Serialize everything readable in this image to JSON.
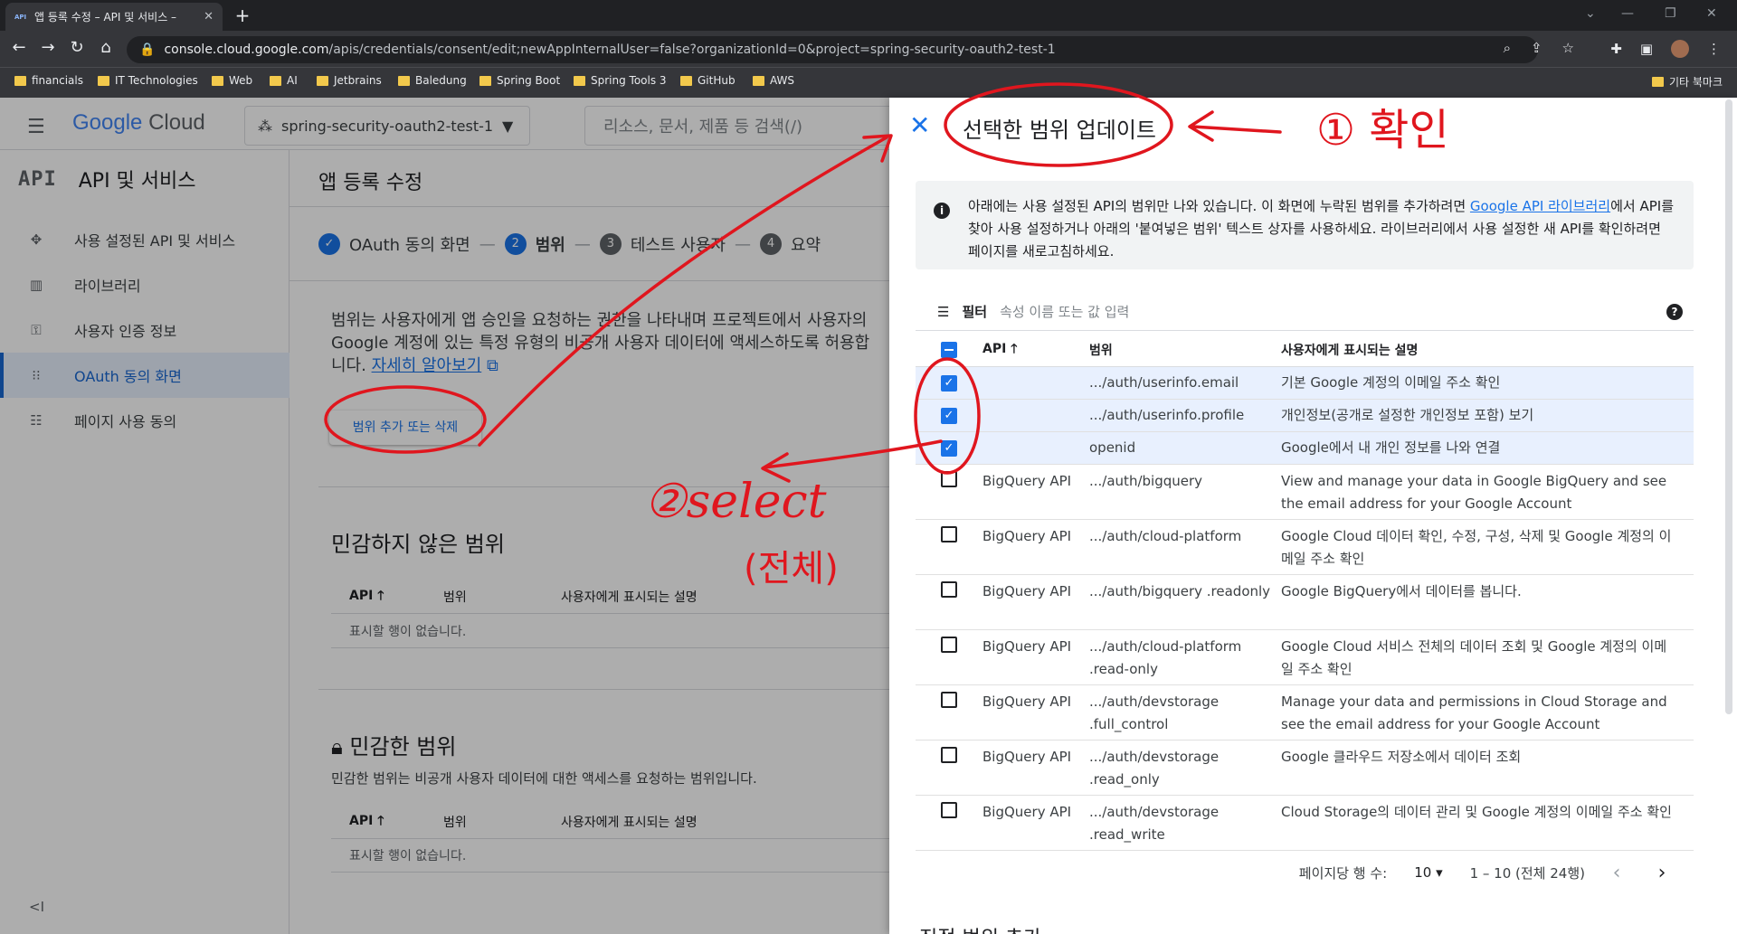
{
  "browser": {
    "tab_title": "앱 등록 수정 – API 및 서비스 –",
    "favicon_text": "API",
    "url_host": "console.cloud.google.com",
    "url_path": "/apis/credentials/consent/edit;newAppInternalUser=false?organizationId=0&project=spring-security-oauth2-test-1",
    "bookmarks": [
      "financials",
      "IT Technologies",
      "Web",
      "AI",
      "Jetbrains",
      "Baledung",
      "Spring Boot",
      "Spring Tools 3",
      "GitHub",
      "AWS"
    ],
    "other_bookmarks": "기타 북마크"
  },
  "header": {
    "logo_google": "Google",
    "logo_cloud": "Cloud",
    "project": "spring-security-oauth2-test-1",
    "search_placeholder": "리소스, 문서, 제품 등 검색(/)"
  },
  "sidebar": {
    "icon_text": "API",
    "title": "API 및 서비스",
    "items": [
      {
        "label": "사용 설정된 API 및 서비스",
        "icon": "diamond-icon"
      },
      {
        "label": "라이브러리",
        "icon": "library-icon"
      },
      {
        "label": "사용자 인증 정보",
        "icon": "key-icon"
      },
      {
        "label": "OAuth 동의 화면",
        "icon": "consent-icon",
        "active": true
      },
      {
        "label": "페이지 사용 동의",
        "icon": "settings-list-icon"
      }
    ],
    "collapse": "<I"
  },
  "main": {
    "page_title": "앱 등록 수정",
    "steps": [
      {
        "num": "✓",
        "label": "OAuth 동의 화면"
      },
      {
        "num": "2",
        "label": "범위"
      },
      {
        "num": "3",
        "label": "테스트 사용자"
      },
      {
        "num": "4",
        "label": "요약"
      }
    ],
    "description": "범위는 사용자에게 앱 승인을 요청하는 권한을 나타내며 프로젝트에서 사용자의 Google 계정에 있는 특정 유형의 비공개 사용자 데이터에 액세스하도록 허용합니다.",
    "learn_more": "자세히 알아보기",
    "add_scope_button": "범위 추가 또는 삭제",
    "non_sensitive_title": "민감하지 않은 범위",
    "sensitive_title": "민감한 범위",
    "sensitive_desc": "민감한 범위는 비공개 사용자 데이터에 대한 액세스를 요청하는 범위입니다.",
    "col_api": "API",
    "col_scope": "범위",
    "col_desc": "사용자에게 표시되는 설명",
    "no_rows": "표시할 행이 없습니다."
  },
  "drawer": {
    "title": "선택한 범위 업데이트",
    "info_text_1": "아래에는 사용 설정된 API의 범위만 나와 있습니다. 이 화면에 누락된 범위를 추가하려면 ",
    "info_link": "Google API 라이브러리",
    "info_text_2": "에서 API를 찾아 사용 설정하거나 아래의 '붙여넣은 범위' 텍스트 상자를 사용하세요. 라이브러리에서 사용 설정한 새 API를 확인하려면 페이지를 새로고침하세요.",
    "filter_label": "필터",
    "filter_placeholder": "속성 이름 또는 값 입력",
    "columns": [
      "API",
      "범위",
      "사용자에게 표시되는 설명"
    ],
    "rows": [
      {
        "checked": true,
        "api": "",
        "scope": ".../auth/userinfo.email",
        "desc": "기본 Google 계정의 이메일 주소 확인"
      },
      {
        "checked": true,
        "api": "",
        "scope": ".../auth/userinfo.profile",
        "desc": "개인정보(공개로 설정한 개인정보 포함) 보기"
      },
      {
        "checked": true,
        "api": "",
        "scope": "openid",
        "desc": "Google에서 내 개인 정보를 나와 연결"
      },
      {
        "checked": false,
        "api": "BigQuery API",
        "scope": ".../auth/bigquery",
        "desc": "View and manage your data in Google BigQuery and see the email address for your Google Account"
      },
      {
        "checked": false,
        "api": "BigQuery API",
        "scope": ".../auth/cloud-platform",
        "desc": "Google Cloud 데이터 확인, 수정, 구성, 삭제 및 Google 계정의 이메일 주소 확인"
      },
      {
        "checked": false,
        "api": "BigQuery API",
        "scope": ".../auth/bigquery .readonly",
        "desc": "Google BigQuery에서 데이터를 봅니다."
      },
      {
        "checked": false,
        "api": "BigQuery API",
        "scope": ".../auth/cloud-platform .read-only",
        "desc": "Google Cloud 서비스 전체의 데이터 조회 및 Google 계정의 이메일 주소 확인"
      },
      {
        "checked": false,
        "api": "BigQuery API",
        "scope": ".../auth/devstorage .full_control",
        "desc": "Manage your data and permissions in Cloud Storage and see the email address for your Google Account"
      },
      {
        "checked": false,
        "api": "BigQuery API",
        "scope": ".../auth/devstorage .read_only",
        "desc": "Google 클라우드 저장소에서 데이터 조회"
      },
      {
        "checked": false,
        "api": "BigQuery API",
        "scope": ".../auth/devstorage .read_write",
        "desc": "Cloud Storage의 데이터 관리 및 Google 계정의 이메일 주소 확인"
      }
    ],
    "rows_per_page_label": "페이지당 행 수:",
    "rows_per_page": "10",
    "range": "1 – 10 (전체 24행)",
    "cutoff_text": "직접 범위 추가"
  },
  "annotations": {
    "confirm": "① 확인",
    "select": "②select",
    "all": "(전체)"
  }
}
